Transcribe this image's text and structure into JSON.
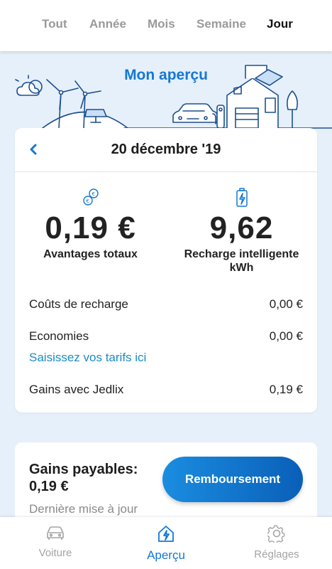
{
  "tabs": [
    {
      "label": "Tout",
      "active": false
    },
    {
      "label": "Année",
      "active": false
    },
    {
      "label": "Mois",
      "active": false
    },
    {
      "label": "Semaine",
      "active": false
    },
    {
      "label": "Jour",
      "active": true
    }
  ],
  "hero": {
    "title": "Mon aperçu"
  },
  "card": {
    "date": "20 décembre '19",
    "stats": [
      {
        "icon": "coins-icon",
        "value": "0,19 €",
        "label": "Avantages totaux"
      },
      {
        "icon": "battery-charging-icon",
        "value": "9,62",
        "label": "Recharge intelligente",
        "unit": "kWh"
      }
    ],
    "rows": {
      "charging_costs": {
        "label": "Coûts de recharge",
        "value": "0,00 €"
      },
      "savings": {
        "label": "Economies",
        "value": "0,00 €"
      },
      "tariff_link": "Saisissez vos tarifs ici",
      "jedlix_gains": {
        "label": "Gains avec Jedlix",
        "value": "0,19 €"
      }
    }
  },
  "payout": {
    "title": "Gains payables:",
    "amount": "0,19 €",
    "button": "Remboursement",
    "note": "Dernière mise à jour"
  },
  "nav": [
    {
      "label": "Voiture",
      "icon": "car-icon",
      "active": false
    },
    {
      "label": "Aperçu",
      "icon": "home-bolt-icon",
      "active": true
    },
    {
      "label": "Réglages",
      "icon": "gear-icon",
      "active": false
    }
  ],
  "colors": {
    "accent": "#1478d4",
    "background": "#e6f0fb",
    "link": "#1a8cc4"
  }
}
